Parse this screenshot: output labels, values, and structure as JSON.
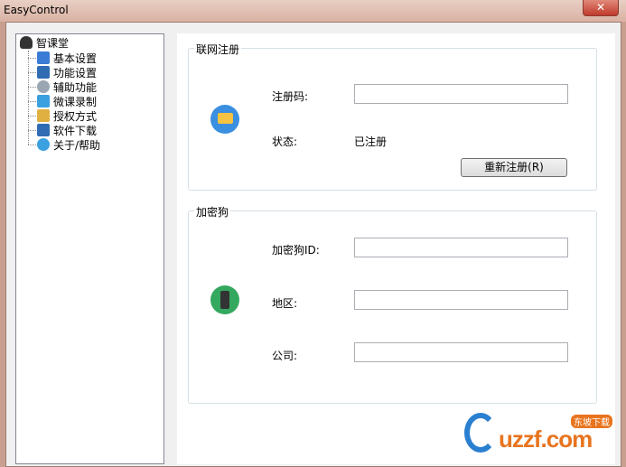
{
  "window": {
    "title": "EasyControl",
    "close_label": "✕"
  },
  "tree": {
    "root": "智课堂",
    "items": [
      {
        "label": "基本设置",
        "icon": "monitor-icon",
        "color": "#3a7bd5"
      },
      {
        "label": "功能设置",
        "icon": "screen-icon",
        "color": "#2f6cb3"
      },
      {
        "label": "辅助功能",
        "icon": "magnifier-icon",
        "color": "#9aa6b2"
      },
      {
        "label": "微课录制",
        "icon": "card-icon",
        "color": "#3aa0e0"
      },
      {
        "label": "授权方式",
        "icon": "user-key-icon",
        "color": "#e0b040"
      },
      {
        "label": "软件下载",
        "icon": "screen-icon",
        "color": "#2f6cb3"
      },
      {
        "label": "关于/帮助",
        "icon": "info-icon",
        "color": "#3aa0e0"
      }
    ]
  },
  "online": {
    "title": "联网注册",
    "code_label": "注册码:",
    "code_value": "",
    "status_label": "状态:",
    "status_value": "已注册",
    "reregister_button": "重新注册(R)"
  },
  "dongle": {
    "title": "加密狗",
    "id_label": "加密狗ID:",
    "id_value": "",
    "region_label": "地区:",
    "region_value": "",
    "company_label": "公司:",
    "company_value": ""
  },
  "watermark": {
    "text": "uzzf.com",
    "badge": "东坡下载"
  }
}
